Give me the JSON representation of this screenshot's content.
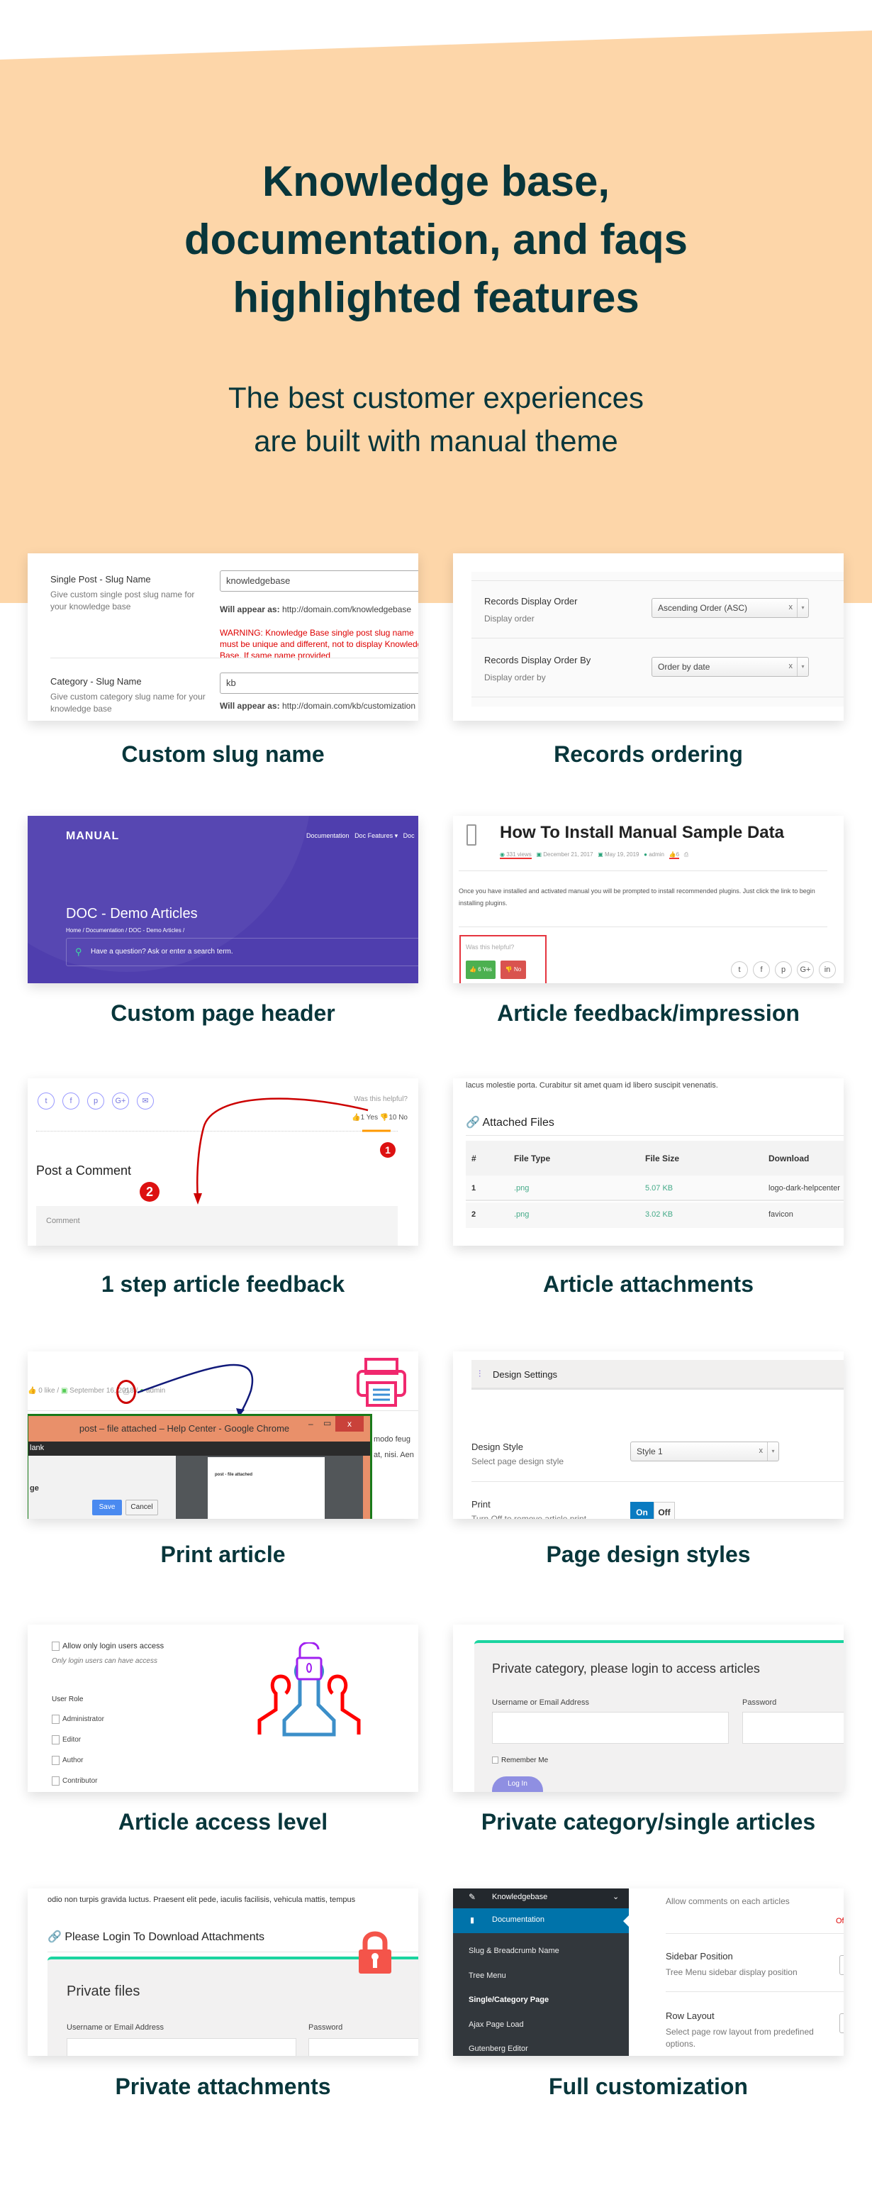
{
  "hero": {
    "title_lines": [
      "Knowledge base,",
      "documentation, and faqs",
      "highlighted features"
    ],
    "subtitle_lines": [
      "The best customer experiences",
      "are built with manual theme"
    ],
    "bg_color": "#fdd6a9",
    "text_color": "#08363b"
  },
  "features": [
    {
      "caption": "Custom slug name",
      "single_label": "Single Post - Slug Name",
      "single_desc": "Give custom single post slug name for your knowledge base",
      "single_value": "knowledgebase",
      "single_appear_prefix": "Will appear as:",
      "single_appear_url": "http://domain.com/knowledgebase",
      "warning_prefix": "WARNING:",
      "warning_text": "Knowledge Base single post slug name must be unique and different, not to display Knowledge Base. If same name provided",
      "cat_label": "Category - Slug Name",
      "cat_desc": "Give custom category slug name for your knowledge base",
      "cat_value": "kb",
      "cat_appear_url": "http://domain.com/kb/customization"
    },
    {
      "caption": "Records ordering",
      "order_label": "Records Display Order",
      "order_desc": "Display order",
      "order_value": "Ascending Order (ASC)",
      "orderby_label": "Records Display Order By",
      "orderby_desc": "Display order by",
      "orderby_value": "Order by date",
      "clear": "x",
      "arrow": "▾"
    },
    {
      "caption": "Custom page header",
      "logo": "MANUAL",
      "nav": [
        "Documentation",
        "Doc Features ▾",
        "Doc"
      ],
      "title": "DOC - Demo Articles",
      "breadcrumb": "Home  /  Documentation  /  DOC - Demo Articles  /",
      "search_placeholder": "Have a question? Ask or enter a search term.",
      "bg_color": "#4f3eae"
    },
    {
      "caption": "Article feedback/impression",
      "title": "How To Install Manual Sample Data",
      "meta": {
        "views": "331 views",
        "created": "December 21, 2017",
        "updated": "May 19, 2019",
        "author": "admin",
        "likes": "6"
      },
      "body": "Once you have installed and activated manual you will be prompted to install recommended plugins. Just click the link to begin installing plugins.",
      "helpful": "Was this helpful?",
      "yes": "6 Yes",
      "no": "No",
      "social": [
        "t",
        "f",
        "p",
        "G+",
        "in"
      ]
    },
    {
      "caption": "1 step article feedback",
      "social": [
        "t",
        "f",
        "p",
        "G+",
        "✉"
      ],
      "helpful": "Was this helpful?",
      "yes": "1 Yes",
      "no": "10 No",
      "post_comment": "Post a Comment",
      "comment_placeholder": "Comment",
      "step1": "1",
      "step2": "2"
    },
    {
      "caption": "Article attachments",
      "lead": "lacus molestie porta. Curabitur sit amet quam id libero suscipit venenatis.",
      "heading": "Attached Files",
      "columns": [
        "#",
        "File Type",
        "File Size",
        "Download"
      ],
      "rows": [
        [
          "1",
          ".png",
          "5.07 KB",
          "logo-dark-helpcenter"
        ],
        [
          "2",
          ".png",
          "3.02 KB",
          "favicon"
        ]
      ]
    },
    {
      "caption": "Print article",
      "meta": {
        "likes": "0 like",
        "date": "September 16, 2018",
        "author": "admin"
      },
      "window_title": "post – file attached – Help Center - Google Chrome",
      "tab_text": "lank",
      "side_text": "ge",
      "preview_title": "post - file attached",
      "save": "Save",
      "cancel": "Cancel",
      "bg_text": [
        "modo feug",
        "at, nisi. Aen"
      ],
      "close": "x"
    },
    {
      "caption": "Page design styles",
      "header": "Design Settings",
      "style_label": "Design Style",
      "style_desc": "Select page design style",
      "style_value": "Style 1",
      "print_label": "Print",
      "print_desc": "Turn Off to remove article print",
      "on": "On",
      "off": "Off",
      "print_on": true
    },
    {
      "caption": "Article access level",
      "allow_label": "Allow only login users access",
      "allow_desc": "Only login users can have access",
      "role_heading": "User Role",
      "roles": [
        "Administrator",
        "Editor",
        "Author",
        "Contributor"
      ]
    },
    {
      "caption": "Private category/single articles",
      "title": "Private category, please login to access articles",
      "user_label": "Username or Email Address",
      "pass_label": "Password",
      "remember": "Remember Me",
      "login": "Log In"
    },
    {
      "caption": "Private attachments",
      "lead": "odio non turpis gravida luctus. Praesent elit pede, iaculis facilisis, vehicula mattis, tempus",
      "heading": "Please Login To Download Attachments",
      "panel_title": "Private files",
      "user_label": "Username or Email Address",
      "pass_label": "Password"
    },
    {
      "caption": "Full customization",
      "menu_top": "Knowledgebase",
      "menu_active": "Documentation",
      "submenu": [
        "Slug & Breadcrumb Name",
        "Tree Menu",
        "Single/Category Page",
        "Ajax Page Load",
        "Gutenberg Editor"
      ],
      "submenu_current": "Single/Category Page",
      "comments_desc": "Allow comments on each articles",
      "off_text": "Of",
      "sidebar_label": "Sidebar Position",
      "sidebar_desc": "Tree Menu sidebar display position",
      "row_label": "Row Layout",
      "row_desc": "Select page row layout from predefined options."
    }
  ]
}
